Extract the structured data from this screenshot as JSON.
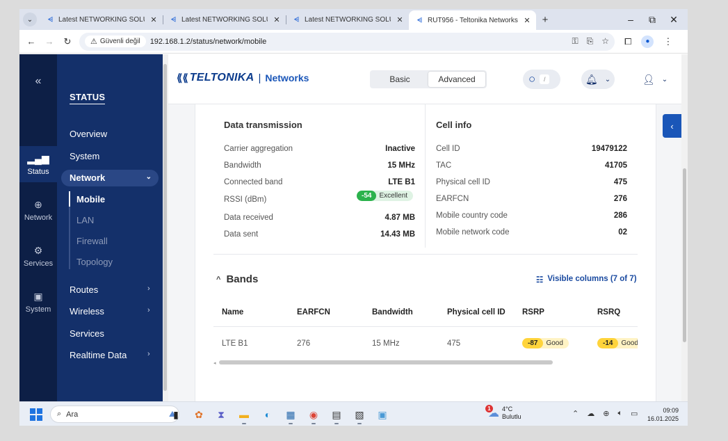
{
  "browser": {
    "tabs": [
      {
        "title": "Latest NETWORKING SOLUTION",
        "active": false
      },
      {
        "title": "Latest NETWORKING SOLUTION",
        "active": false
      },
      {
        "title": "Latest NETWORKING SOLUTION",
        "active": false
      },
      {
        "title": "RUT956 - Teltonika Networks",
        "active": true
      }
    ],
    "security_label": "Güvenli değil",
    "url": "192.168.1.2/status/network/mobile"
  },
  "rail": {
    "collapse": "«",
    "items": [
      {
        "label": "Status",
        "icon": "signal-icon"
      },
      {
        "label": "Network",
        "icon": "globe-icon"
      },
      {
        "label": "Services",
        "icon": "gear-icon"
      },
      {
        "label": "System",
        "icon": "device-icon"
      }
    ]
  },
  "menu": {
    "heading": "STATUS",
    "overview": "Overview",
    "system": "System",
    "network": "Network",
    "network_sub": [
      "Mobile",
      "LAN",
      "Firewall",
      "Topology"
    ],
    "routes": "Routes",
    "wireless": "Wireless",
    "services": "Services",
    "realtime": "Realtime Data"
  },
  "header": {
    "brand": "TELTONIKA",
    "brand_sub": "Networks",
    "mode_basic": "Basic",
    "mode_advanced": "Advanced",
    "search_hint": "/"
  },
  "data_transmission": {
    "title": "Data transmission",
    "rows": [
      {
        "label": "Carrier aggregation",
        "value": "Inactive"
      },
      {
        "label": "Bandwidth",
        "value": "15 MHz"
      },
      {
        "label": "Connected band",
        "value": "LTE B1"
      },
      {
        "label": "RSSI (dBm)",
        "value": ""
      },
      {
        "label": "Data received",
        "value": "4.87 MB"
      },
      {
        "label": "Data sent",
        "value": "14.43 MB"
      }
    ],
    "rssi_value": "-54",
    "rssi_quality": "Excellent"
  },
  "cell_info": {
    "title": "Cell info",
    "rows": [
      {
        "label": "Cell ID",
        "value": "19479122"
      },
      {
        "label": "TAC",
        "value": "41705"
      },
      {
        "label": "Physical cell ID",
        "value": "475"
      },
      {
        "label": "EARFCN",
        "value": "276"
      },
      {
        "label": "Mobile country code",
        "value": "286"
      },
      {
        "label": "Mobile network code",
        "value": "02"
      }
    ]
  },
  "bands": {
    "title": "Bands",
    "visible_columns": "Visible columns (7 of 7)",
    "columns": [
      "Name",
      "EARFCN",
      "Bandwidth",
      "Physical cell ID",
      "RSRP",
      "RSRQ"
    ],
    "row": {
      "name": "LTE B1",
      "earfcn": "276",
      "bandwidth": "15 MHz",
      "pci": "475",
      "rsrp": "-87",
      "rsrp_quality": "Good",
      "rsrq": "-14",
      "rsrq_quality": "Good"
    }
  },
  "taskbar": {
    "search": "Ara",
    "weather_temp": "4°C",
    "weather_desc": "Bulutlu",
    "weather_badge": "1",
    "time": "09:09",
    "date": "16.01.2025"
  },
  "colors": {
    "rail": "#0d1f46",
    "menu": "#14306a",
    "accent": "#1a56b8",
    "good_green": "#2bb24c",
    "warn_yellow": "#ffd43b"
  }
}
